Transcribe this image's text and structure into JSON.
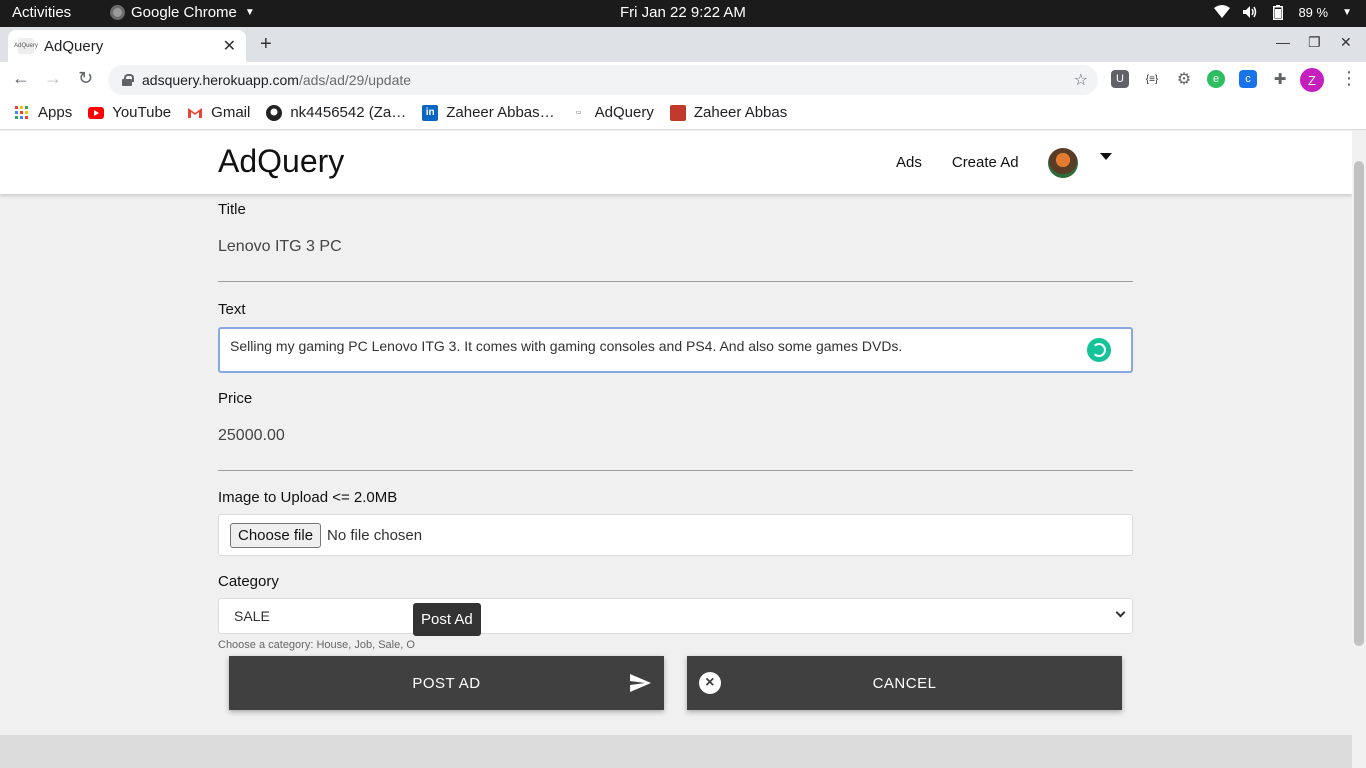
{
  "os_bar": {
    "activities": "Activities",
    "app_name": "Google Chrome",
    "clock": "Fri Jan 22  9:22 AM",
    "battery": "89 %"
  },
  "browser": {
    "tab_title": "AdQuery",
    "tab_favicon_text": "AdQuery",
    "url_host": "adsquery.herokuapp.com",
    "url_path": "/ads/ad/29/update",
    "profile_initial": "Z",
    "bookmarks": [
      {
        "label": "Apps",
        "icon": "apps-grid-icon"
      },
      {
        "label": "YouTube",
        "icon": "youtube-icon"
      },
      {
        "label": "Gmail",
        "icon": "gmail-icon"
      },
      {
        "label": "nk4456542 (Za…",
        "icon": "github-icon"
      },
      {
        "label": "Zaheer Abbas…",
        "icon": "linkedin-icon"
      },
      {
        "label": "AdQuery",
        "icon": "adquery-icon"
      },
      {
        "label": "Zaheer Abbas",
        "icon": "profile-photo-icon"
      }
    ]
  },
  "site": {
    "brand": "AdQuery",
    "nav": {
      "ads": "Ads",
      "create_ad": "Create Ad"
    }
  },
  "form": {
    "title_label": "Title",
    "title_value": "Lenovo ITG 3 PC",
    "text_label": "Text",
    "text_value": "Selling my gaming PC Lenovo ITG 3. It comes with gaming consoles and PS4. And also some games DVDs.",
    "price_label": "Price",
    "price_value": "25000.00",
    "image_label": "Image to Upload <= 2.0MB",
    "choose_file": "Choose file",
    "no_file": "No file chosen",
    "category_label": "Category",
    "category_value": "SALE",
    "category_helper": "Choose a category: House, Job, Sale, O",
    "tooltip": "Post Ad",
    "post_button": "POST AD",
    "cancel_button": "CANCEL"
  },
  "colors": {
    "button_bg": "#404040",
    "focus_border": "#89a7e0",
    "grammarly": "#15c39a",
    "profile": "#c51fc0"
  }
}
